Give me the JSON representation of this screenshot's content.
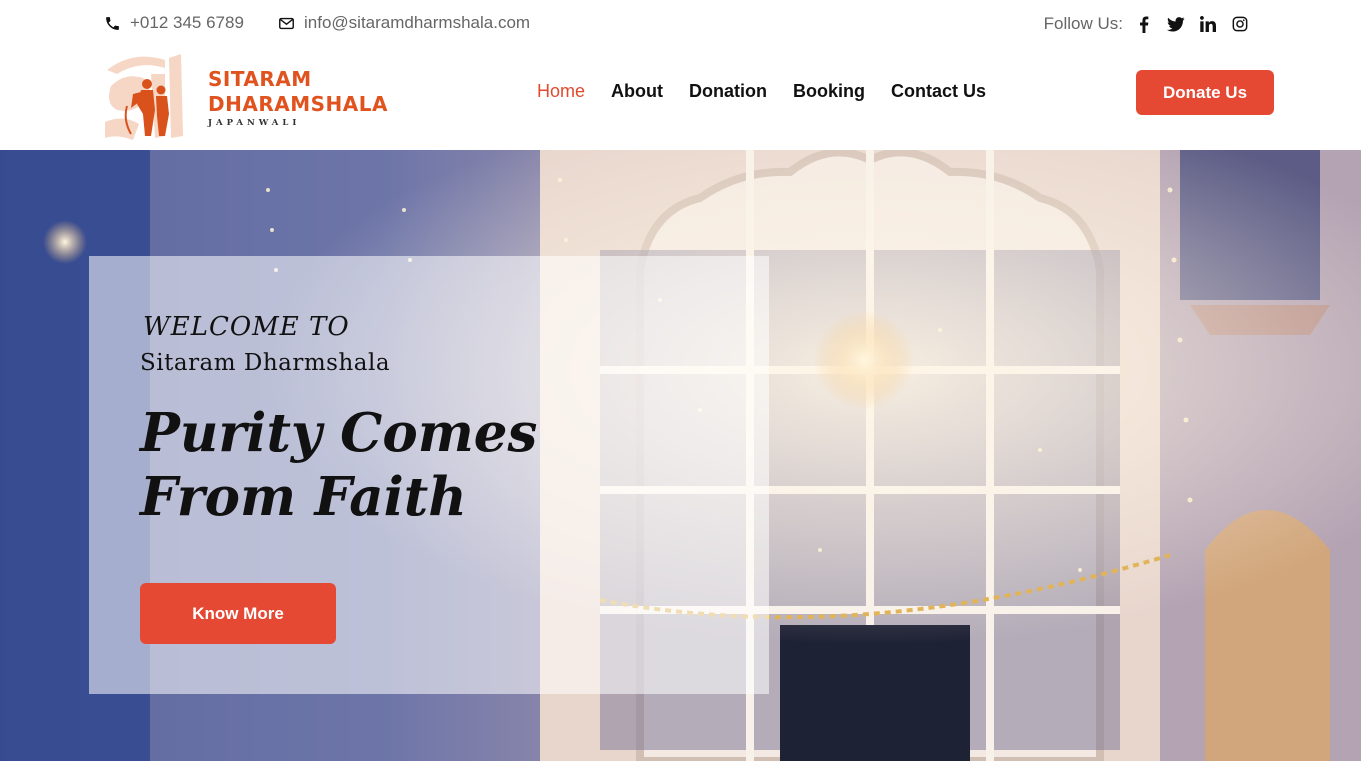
{
  "topbar": {
    "phone": "+012 345 6789",
    "email": "info@sitaramdharmshala.com",
    "follow_label": "Follow Us:",
    "socials": [
      "facebook-icon",
      "twitter-icon",
      "linkedin-icon",
      "instagram-icon"
    ]
  },
  "brand": {
    "line1": "SITARAM",
    "line2": "DHARAMSHALA",
    "line3": "JAPANWALI",
    "color": "#e0531f"
  },
  "nav": {
    "items": [
      {
        "label": "Home",
        "active": true
      },
      {
        "label": "About",
        "active": false
      },
      {
        "label": "Donation",
        "active": false
      },
      {
        "label": "Booking",
        "active": false
      },
      {
        "label": "Contact Us",
        "active": false
      }
    ],
    "active_color": "#e04a2f"
  },
  "header": {
    "donate_label": "Donate Us"
  },
  "hero": {
    "welcome": "WELCOME TO",
    "subtitle": "Sitaram Dharmshala",
    "headline_line1": "Purity Comes",
    "headline_line2": "From Faith",
    "cta_label": "Know More"
  },
  "colors": {
    "accent": "#e64933"
  }
}
